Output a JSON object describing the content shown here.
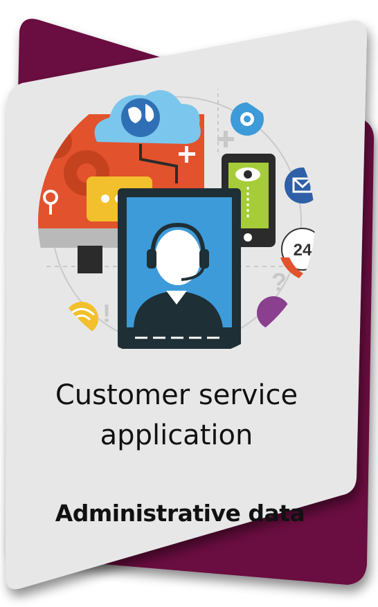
{
  "card": {
    "title_line_1": "Customer service",
    "title_line_2": "application",
    "subtitle": "Administrative data"
  },
  "illustration": {
    "clock_label": "24",
    "icons": [
      "globe-icon",
      "cloud-icon",
      "gear-icon",
      "envelope-icon",
      "eye-icon",
      "chat-bubble-icon",
      "headset-agent-icon",
      "clock-24-icon",
      "phone-handset-icon",
      "wifi-icon",
      "question-mark-icon",
      "exclamation-icon",
      "map-pin-icon",
      "plus-icon"
    ]
  },
  "colors": {
    "back_panel": "#6b1040",
    "card": "#e7e7e7",
    "monitor": "#e2522d",
    "tablet_frame": "#1f2f36",
    "tablet_screen": "#3d9bd9",
    "cloud": "#7bc6ec",
    "chat": "#f2c02c",
    "phone_screen": "#a6cc3a",
    "envelope_circle": "#2f5fa7"
  }
}
